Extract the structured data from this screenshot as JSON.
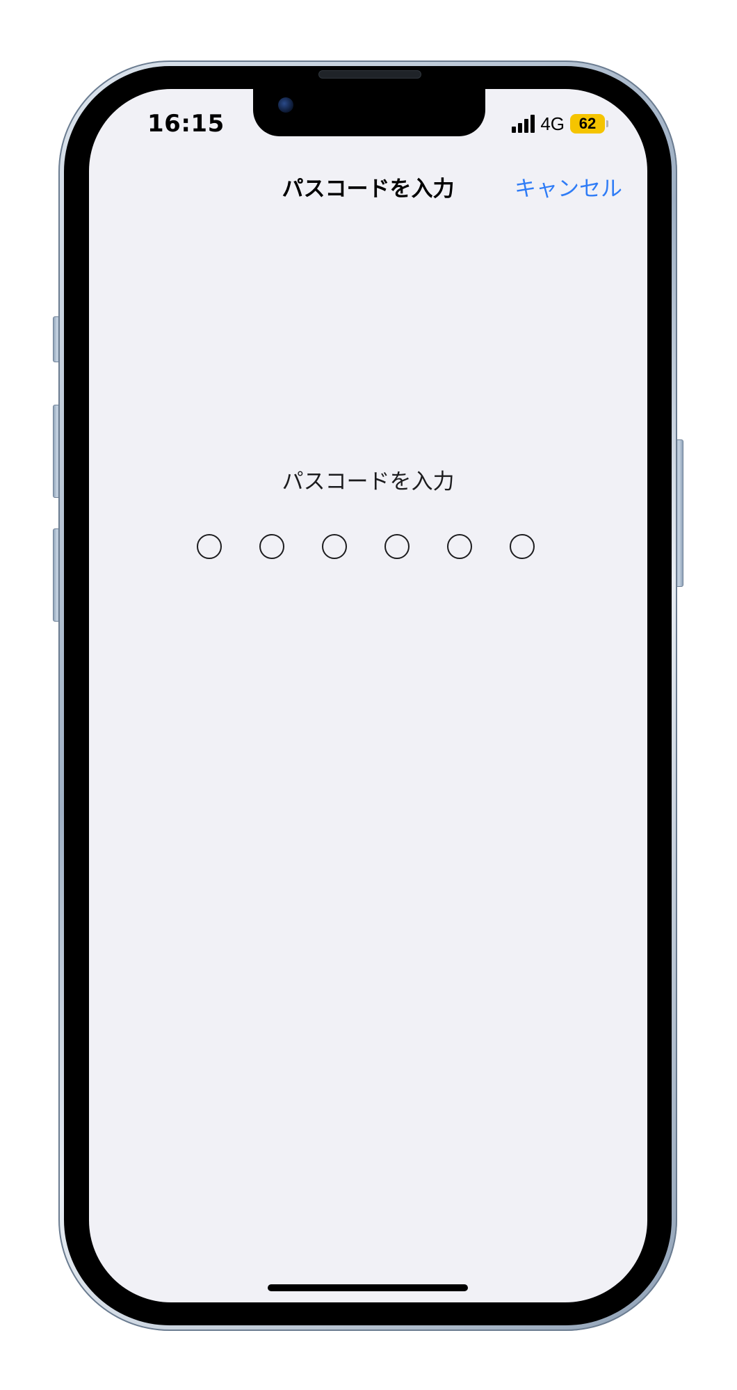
{
  "status_bar": {
    "time": "16:15",
    "network": "4G",
    "battery_level": "62",
    "signal_icon": "cellular-signal-icon",
    "battery_icon": "battery-icon",
    "battery_color": "#f5c400"
  },
  "nav": {
    "title": "パスコードを入力",
    "cancel_label": "キャンセル",
    "accent_color": "#2f7cf6"
  },
  "passcode": {
    "prompt": "パスコードを入力",
    "digit_count": 6,
    "entered_count": 0
  }
}
